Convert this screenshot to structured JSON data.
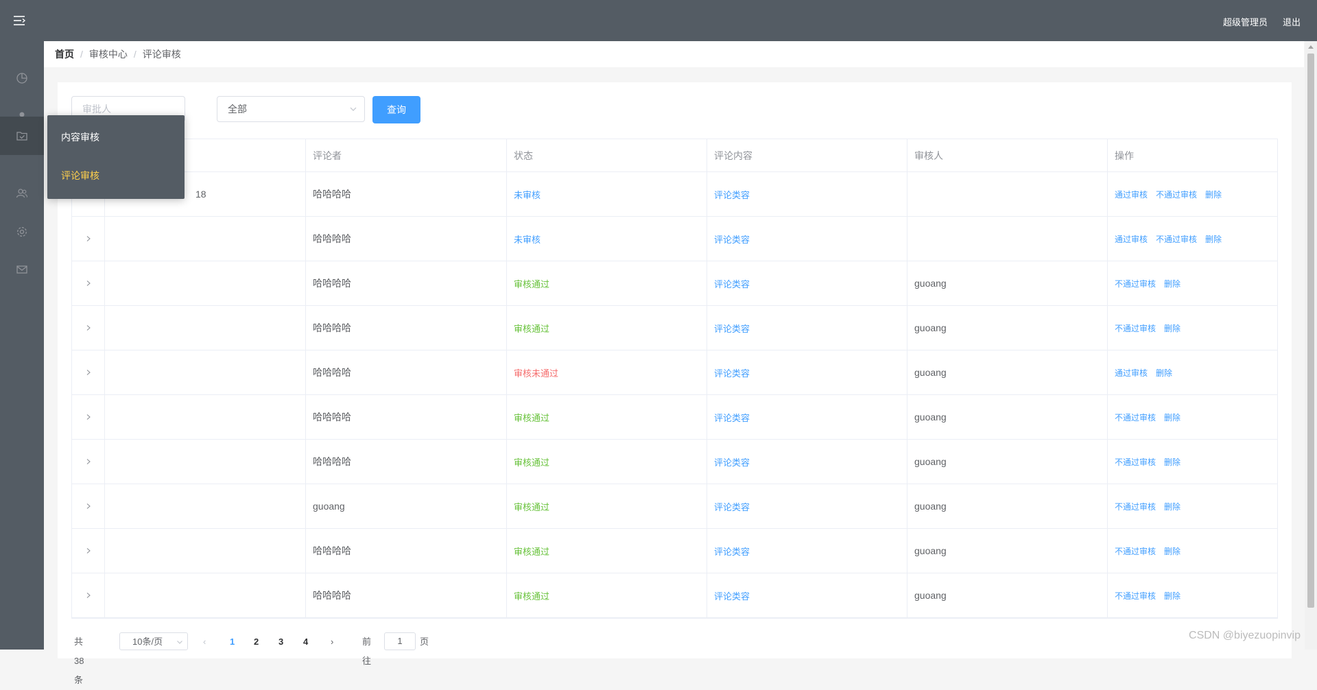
{
  "header": {
    "user_label": "超级管理员",
    "logout_label": "退出"
  },
  "submenu": {
    "items": [
      {
        "label": "内容审核"
      },
      {
        "label": "评论审核"
      }
    ]
  },
  "breadcrumb": {
    "home": "首页",
    "sep": "/",
    "parent": "审核中心",
    "current": "评论审核"
  },
  "filters": {
    "approver_placeholder": "审批人",
    "status_selected": "全部",
    "query_label": "查询"
  },
  "table": {
    "columns": [
      "",
      "评论者",
      "状态",
      "评论内容",
      "审核人",
      "操作"
    ],
    "partial_first_cell": "18",
    "rows": [
      {
        "commenter": "哈哈哈哈",
        "status": "未审核",
        "content": "评论类容",
        "auditor": "",
        "ops": [
          "通过审核",
          "不通过审核",
          "删除"
        ]
      },
      {
        "commenter": "哈哈哈哈",
        "status": "未审核",
        "content": "评论类容",
        "auditor": "",
        "ops": [
          "通过审核",
          "不通过审核",
          "删除"
        ]
      },
      {
        "commenter": "哈哈哈哈",
        "status": "审核通过",
        "content": "评论类容",
        "auditor": "guoang",
        "ops": [
          "不通过审核",
          "删除"
        ]
      },
      {
        "commenter": "哈哈哈哈",
        "status": "审核通过",
        "content": "评论类容",
        "auditor": "guoang",
        "ops": [
          "不通过审核",
          "删除"
        ]
      },
      {
        "commenter": "哈哈哈哈",
        "status": "审核未通过",
        "content": "评论类容",
        "auditor": "guoang",
        "ops": [
          "通过审核",
          "删除"
        ]
      },
      {
        "commenter": "哈哈哈哈",
        "status": "审核通过",
        "content": "评论类容",
        "auditor": "guoang",
        "ops": [
          "不通过审核",
          "删除"
        ]
      },
      {
        "commenter": "哈哈哈哈",
        "status": "审核通过",
        "content": "评论类容",
        "auditor": "guoang",
        "ops": [
          "不通过审核",
          "删除"
        ]
      },
      {
        "commenter": "guoang",
        "status": "审核通过",
        "content": "评论类容",
        "auditor": "guoang",
        "ops": [
          "不通过审核",
          "删除"
        ]
      },
      {
        "commenter": "哈哈哈哈",
        "status": "审核通过",
        "content": "评论类容",
        "auditor": "guoang",
        "ops": [
          "不通过审核",
          "删除"
        ]
      },
      {
        "commenter": "哈哈哈哈",
        "status": "审核通过",
        "content": "评论类容",
        "auditor": "guoang",
        "ops": [
          "不通过审核",
          "删除"
        ]
      }
    ]
  },
  "pagination": {
    "total_label": "共 38 条",
    "page_size": "10条/页",
    "pages": [
      "1",
      "2",
      "3",
      "4"
    ],
    "current_page": "1",
    "prev_symbol": "‹",
    "next_symbol": "›",
    "goto_label": "前往",
    "goto_value": "1",
    "page_unit": "页"
  },
  "watermark": "CSDN @biyezuopinvip",
  "colors": {
    "sidebar": "#545c64",
    "accent": "#409eff",
    "active_submenu": "#ffd04b",
    "status_pending": "#409eff",
    "status_pass": "#67c23a",
    "status_fail": "#f56c6c"
  },
  "icons": {
    "sidebar": [
      "pie-chart-icon",
      "user-icon",
      "folder-check-icon",
      "users-icon",
      "gear-icon",
      "mail-icon"
    ]
  }
}
